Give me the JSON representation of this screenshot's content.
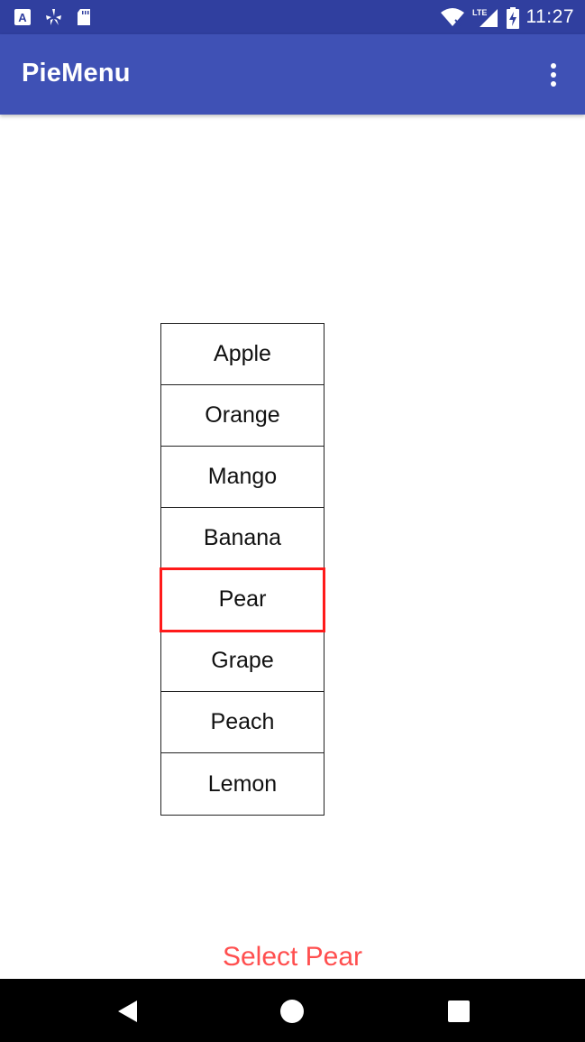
{
  "status_bar": {
    "time": "11:27",
    "left_icons": [
      "a-notification-icon",
      "yelp-icon",
      "sd-card-icon"
    ],
    "right_icons": [
      "wifi-icon",
      "lte-signal-icon",
      "battery-charging-icon"
    ],
    "network_label": "LTE"
  },
  "app_bar": {
    "title": "PieMenu",
    "overflow_icon": "more-vert-icon"
  },
  "fruit_list": {
    "items": [
      {
        "label": "Apple"
      },
      {
        "label": "Orange"
      },
      {
        "label": "Mango"
      },
      {
        "label": "Banana"
      },
      {
        "label": "Pear"
      },
      {
        "label": "Grape"
      },
      {
        "label": "Peach"
      },
      {
        "label": "Lemon"
      }
    ],
    "selected_label": "Pear",
    "selection_color": "#ff1a1a"
  },
  "result": {
    "text": "Select Pear",
    "color": "#ff4f4f"
  },
  "nav_bar": {
    "buttons": [
      "back-icon",
      "home-icon",
      "recents-icon"
    ]
  },
  "colors": {
    "status_bar": "#303f9f",
    "app_bar": "#3f51b5"
  }
}
